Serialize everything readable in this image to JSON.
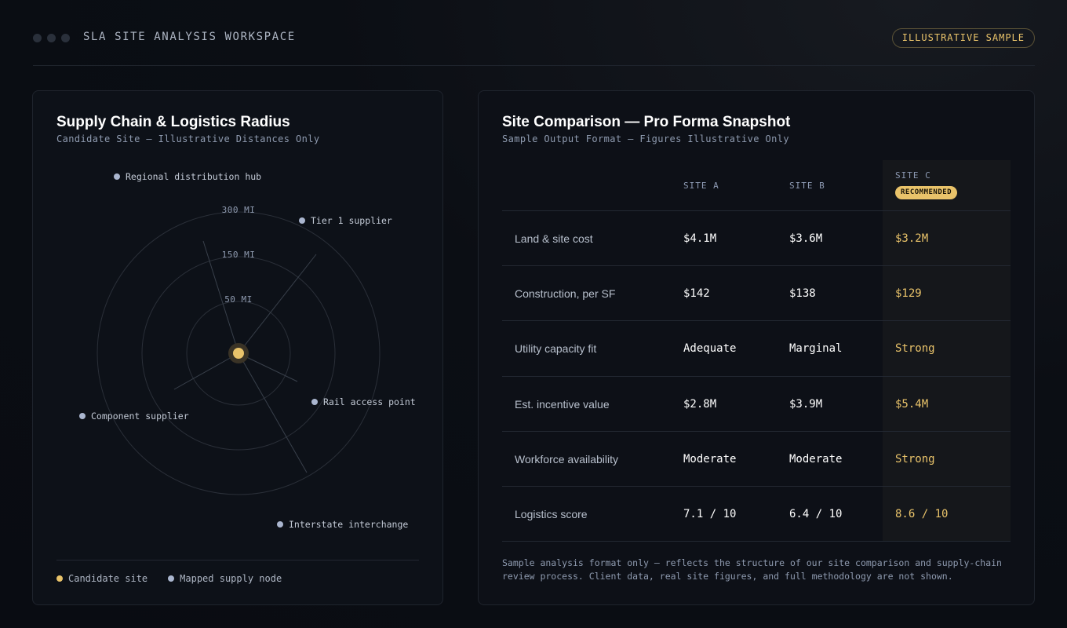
{
  "header": {
    "app_title": "SLA SITE ANALYSIS WORKSPACE",
    "badge": "ILLUSTRATIVE SAMPLE"
  },
  "radius_panel": {
    "title": "Supply Chain & Logistics Radius",
    "subtitle": "Candidate Site — Illustrative Distances Only",
    "rings": [
      "300 MI",
      "150 MI",
      "50 MI"
    ],
    "nodes": [
      {
        "label": "Regional distribution hub"
      },
      {
        "label": "Tier 1 supplier"
      },
      {
        "label": "Rail access point"
      },
      {
        "label": "Component supplier"
      },
      {
        "label": "Interstate interchange"
      }
    ],
    "legend": {
      "candidate": "Candidate site",
      "node": "Mapped supply node"
    },
    "colors": {
      "candidate": "#e9c36a",
      "node": "#aab6cf",
      "ring": "#2a2f38"
    }
  },
  "comparison_panel": {
    "title": "Site Comparison — Pro Forma Snapshot",
    "subtitle": "Sample Output Format — Figures Illustrative Only",
    "columns": [
      "SITE A",
      "SITE B",
      "SITE C"
    ],
    "recommended_badge": "RECOMMENDED",
    "rows": [
      {
        "label": "Land & site cost",
        "values": [
          "$4.1M",
          "$3.6M",
          "$3.2M"
        ]
      },
      {
        "label": "Construction, per SF",
        "values": [
          "$142",
          "$138",
          "$129"
        ]
      },
      {
        "label": "Utility capacity fit",
        "values": [
          "Adequate",
          "Marginal",
          "Strong"
        ]
      },
      {
        "label": "Est. incentive value",
        "values": [
          "$2.8M",
          "$3.9M",
          "$5.4M"
        ]
      },
      {
        "label": "Workforce availability",
        "values": [
          "Moderate",
          "Moderate",
          "Strong"
        ]
      },
      {
        "label": "Logistics score",
        "values": [
          "7.1 / 10",
          "6.4 / 10",
          "8.6 / 10"
        ]
      }
    ],
    "footnote_line1": "Sample analysis format only — reflects the structure of our site comparison and supply-chain",
    "footnote_line2": "review process. Client data, real site figures, and full methodology are not shown."
  }
}
